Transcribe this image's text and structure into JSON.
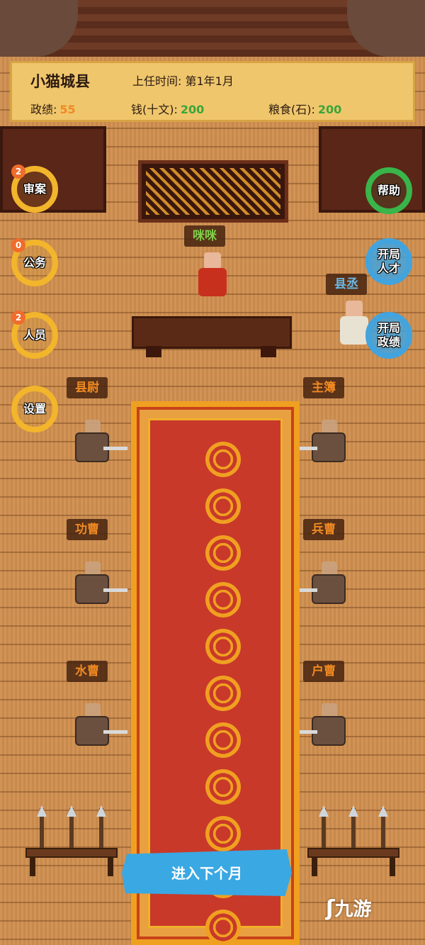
{
  "header": {
    "county": "小猫城县",
    "term_label": "上任时间:",
    "term_value": "第1年1月",
    "merit_label": "政绩:",
    "merit_value": "55",
    "money_label": "钱(十文):",
    "money_value": "200",
    "grain_label": "粮食(石):",
    "grain_value": "200"
  },
  "left_buttons": [
    {
      "label": "审案",
      "badge": "2"
    },
    {
      "label": "公务",
      "badge": "0"
    },
    {
      "label": "人员",
      "badge": "2"
    },
    {
      "label": "设置"
    }
  ],
  "right_buttons": [
    {
      "label": "帮助"
    },
    {
      "label": "开局\n人才"
    },
    {
      "label": "开局\n政绩"
    }
  ],
  "characters": {
    "magistrate": "咪咪",
    "assistant": "县丞",
    "officials": [
      "县尉",
      "主簿",
      "功曹",
      "兵曹",
      "水曹",
      "户曹"
    ]
  },
  "next_month_label": "进入下个月",
  "watermark": "九游",
  "colors": {
    "accent_orange": "#f08a22",
    "accent_green": "#3aa63a",
    "button_blue": "#3aa8e2"
  }
}
